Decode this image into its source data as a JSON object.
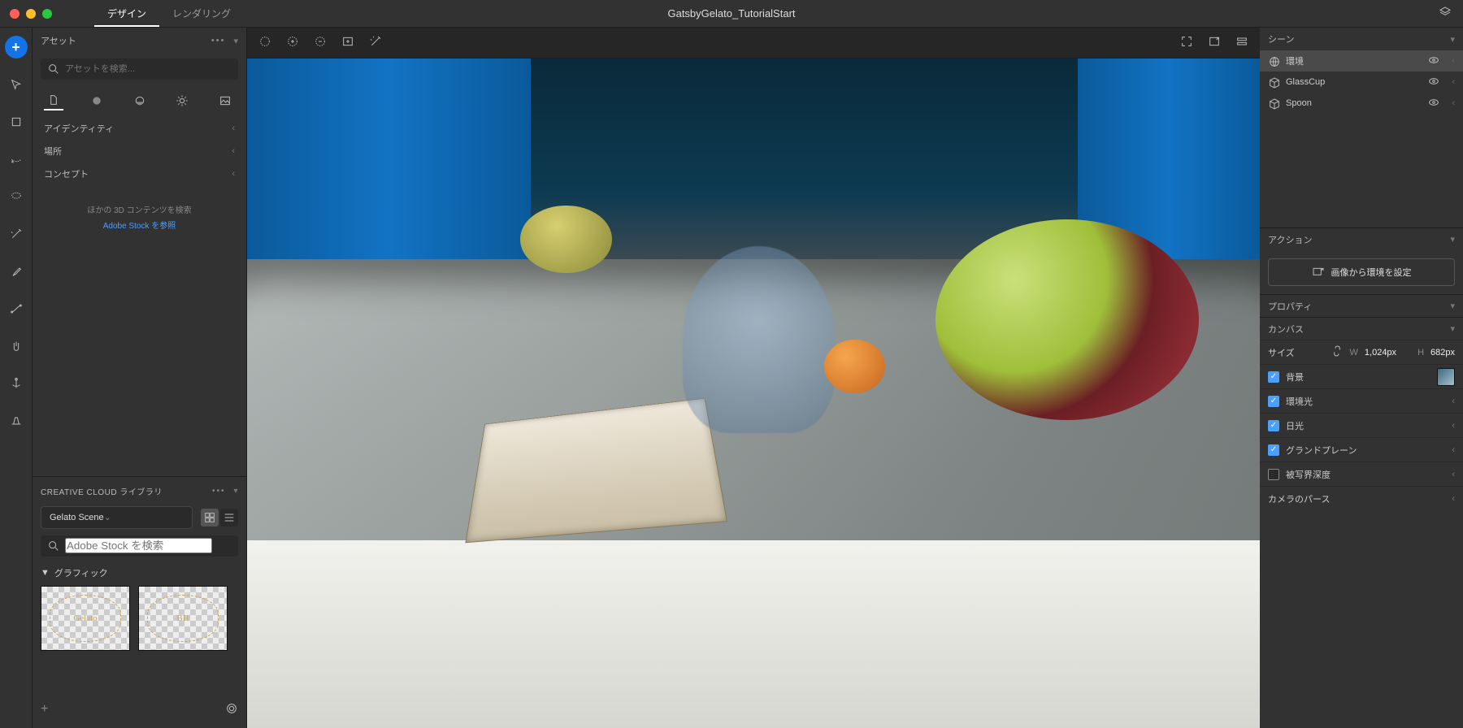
{
  "titlebar": {
    "mode_tabs": [
      "デザイン",
      "レンダリング"
    ],
    "active_mode": 0,
    "doc_title": "GatsbyGelato_TutorialStart"
  },
  "left": {
    "assets_header": "アセット",
    "search_placeholder": "アセットを検索...",
    "category_tabs": [
      "models-icon",
      "materials-icon",
      "lights-icon",
      "sun-icon",
      "images-icon"
    ],
    "accordion": [
      "アイデンティティ",
      "場所",
      "コンセプト"
    ],
    "empty_note": "ほかの 3D コンテンツを検索",
    "stock_link": "Adobe Stock を参照",
    "cc_header": "CREATIVE CLOUD ライブラリ",
    "library_selected": "Gelato Scene",
    "cc_search_placeholder": "Adobe Stock を検索",
    "group_label": "グラフィック",
    "thumb_labels": [
      "Gelato",
      "BH"
    ]
  },
  "viewport": {
    "left_tools": [
      "select-circle",
      "add-circle",
      "remove-circle",
      "image-import",
      "magic-wand"
    ],
    "right_tools": [
      "fullscreen",
      "export",
      "render-settings"
    ]
  },
  "right": {
    "scene_header": "シーン",
    "scene_items": [
      {
        "icon": "globe-icon",
        "label": "環境",
        "active": true,
        "vis": true
      },
      {
        "icon": "cube-icon",
        "label": "GlassCup",
        "active": false,
        "vis": true
      },
      {
        "icon": "cube-icon",
        "label": "Spoon",
        "active": false,
        "vis": true
      }
    ],
    "actions_header": "アクション",
    "action_button": "画像から環境を設定",
    "properties_header": "プロパティ",
    "canvas_header": "カンバス",
    "size_label": "サイズ",
    "width_label": "W",
    "width_value": "1,024px",
    "height_label": "H",
    "height_value": "682px",
    "bg_label": "背景",
    "checks": [
      {
        "label": "環境光",
        "on": true
      },
      {
        "label": "日光",
        "on": true
      },
      {
        "label": "グランドプレーン",
        "on": true
      },
      {
        "label": "被写界深度",
        "on": false
      }
    ],
    "camera_persp": "カメラのパース"
  },
  "tools": [
    "add",
    "move",
    "crop",
    "undo-lasso",
    "lasso",
    "wand",
    "eyedropper",
    "path",
    "hand",
    "anchor",
    "perspective"
  ]
}
